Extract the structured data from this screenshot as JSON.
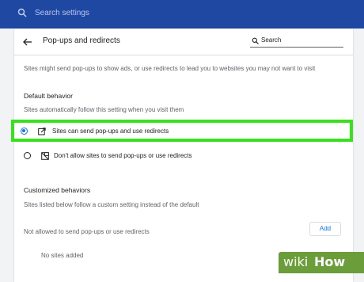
{
  "search": {
    "placeholder": "Search settings"
  },
  "header": {
    "title": "Pop-ups and redirects",
    "search_label": "Search"
  },
  "description": "Sites might send pop-ups to show ads, or use redirects to lead you to websites you may not want to visit",
  "default_behavior": {
    "title": "Default behavior",
    "subtitle": "Sites automatically follow this setting when you visit them",
    "options": [
      {
        "label": "Sites can send pop-ups and use redirects",
        "selected": true,
        "icon": "open-in-new-icon"
      },
      {
        "label": "Don't allow sites to send pop-ups or use redirects",
        "selected": false,
        "icon": "blocked-popup-icon"
      }
    ]
  },
  "customized": {
    "title": "Customized behaviors",
    "subtitle": "Sites listed below follow a custom setting instead of the default",
    "not_allowed_label": "Not allowed to send pop-ups or use redirects",
    "add_label": "Add",
    "empty_text": "No sites added"
  },
  "watermark": {
    "part1": "wiki",
    "part2": "How"
  },
  "colors": {
    "topbar": "#1f48a3",
    "highlight": "#39e01d",
    "accent": "#1a73e8",
    "watermark": "#6b9e3a"
  }
}
